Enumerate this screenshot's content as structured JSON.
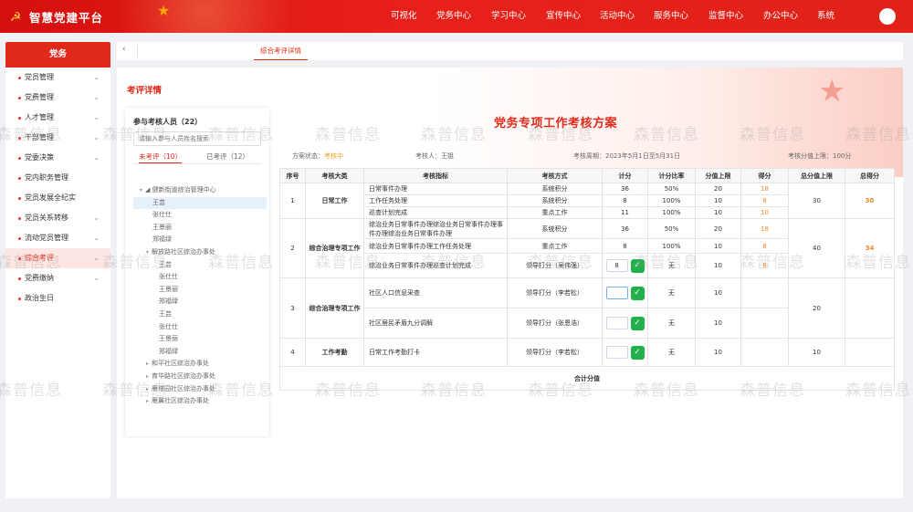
{
  "header": {
    "app_title": "智慧党建平台",
    "nav": [
      "可视化",
      "党务中心",
      "学习中心",
      "宣传中心",
      "活动中心",
      "服务中心",
      "监督中心",
      "办公中心",
      "系统"
    ]
  },
  "sidebar": {
    "title": "党务",
    "items": [
      {
        "label": "党员管理",
        "expandable": true
      },
      {
        "label": "党费管理",
        "expandable": true
      },
      {
        "label": "人才管理",
        "expandable": true
      },
      {
        "label": "干部管理",
        "expandable": true
      },
      {
        "label": "党委决策",
        "expandable": true
      },
      {
        "label": "党内职务管理",
        "expandable": false
      },
      {
        "label": "党员发展全纪实",
        "expandable": false
      },
      {
        "label": "党员关系转移",
        "expandable": true
      },
      {
        "label": "流动党员管理",
        "expandable": true
      },
      {
        "label": "综合考评",
        "expandable": true,
        "active": true
      },
      {
        "label": "党费缴纳",
        "expandable": true
      },
      {
        "label": "政治生日",
        "expandable": false
      }
    ]
  },
  "tabs": {
    "back_icon": "‹",
    "active_tab": "综合考评详情"
  },
  "main": {
    "section_title": "考评详情",
    "plan_title": "党务专项工作考核方案",
    "info": {
      "status_label": "方案状态：",
      "status_value": "考核中",
      "assessor": "考核人：王姐",
      "period": "考核周期：2023年5月1日至5月31日",
      "score_cap": "考核分值上限：100分"
    }
  },
  "tree": {
    "title": "参与考核人员（22）",
    "search_placeholder": "请输入参与人员姓名搜索",
    "tab_pending": "未考评（10）",
    "tab_done": "已考评（12）",
    "rows": [
      {
        "label": "◢ 健新街道综治管理中心",
        "arrow": "▾",
        "indent": 1
      },
      {
        "label": "王芸",
        "indent": 3,
        "selected": true
      },
      {
        "label": "张仕仕",
        "indent": 3
      },
      {
        "label": "王景丽",
        "indent": 3
      },
      {
        "label": "郑福绿",
        "indent": 3
      },
      {
        "label": "解放路社区综治办事处",
        "arrow": "▾",
        "indent": 2
      },
      {
        "label": "王芸",
        "indent": 4
      },
      {
        "label": "张仕仕",
        "indent": 4
      },
      {
        "label": "王景丽",
        "indent": 4
      },
      {
        "label": "郑福绿",
        "indent": 4
      },
      {
        "label": "王芸",
        "indent": 4
      },
      {
        "label": "张仕仕",
        "indent": 4
      },
      {
        "label": "王景丽",
        "indent": 4
      },
      {
        "label": "郑福绿",
        "indent": 4
      },
      {
        "label": "和平社区综治办事处",
        "arrow": "▸",
        "indent": 2
      },
      {
        "label": "育华路社区综治办事处",
        "arrow": "▸",
        "indent": 2
      },
      {
        "label": "雁塔园社区综治办事处",
        "arrow": "▸",
        "indent": 2
      },
      {
        "label": "雁翼社区综治办事处",
        "arrow": "▸",
        "indent": 2
      }
    ]
  },
  "table": {
    "headers": [
      "序号",
      "考核大类",
      "考核指标",
      "考核方式",
      "计分",
      "计分比率",
      "分值上限",
      "得分",
      "总分值上限",
      "总得分"
    ],
    "groups": [
      {
        "no": "1",
        "category": "日常工作",
        "total_cap": "30",
        "total_score": "30",
        "rows": [
          {
            "indicator": "日常事件办理",
            "method": "系统积分",
            "score": "36",
            "ratio": "50%",
            "cap": "20",
            "got": "18"
          },
          {
            "indicator": "工作任务处理",
            "method": "系统积分",
            "score": "8",
            "ratio": "100%",
            "cap": "10",
            "got": "8"
          },
          {
            "indicator": "巡查计划完成",
            "method": "重点工作",
            "score": "11",
            "ratio": "100%",
            "cap": "10",
            "got": "10"
          }
        ]
      },
      {
        "no": "2",
        "category": "综合治理专项工作",
        "total_cap": "40",
        "total_score": "34",
        "rows": [
          {
            "indicator": "综治业务日常事件办理综治业务日常事件办理事件办理综治业务日常事件办理",
            "method": "系统积分",
            "score": "36",
            "ratio": "50%",
            "cap": "20",
            "got": "18"
          },
          {
            "indicator": "综治业务日常事件办理工作任务处理",
            "method": "重点工作",
            "score": "8",
            "ratio": "100%",
            "cap": "10",
            "got": "8"
          },
          {
            "indicator": "综治业务日常事件办理巡查计划完成",
            "method": "领导打分（吴伟强）",
            "score_input": "8",
            "ratio": "无",
            "cap": "10",
            "got": "8"
          }
        ]
      },
      {
        "no": "3",
        "category": "综合治理专项工作",
        "total_cap": "20",
        "total_score": "",
        "rows": [
          {
            "indicator": "社区人口信息采查",
            "method": "领导打分（李若松）",
            "score_input": "",
            "ratio": "无",
            "cap": "10",
            "got": ""
          },
          {
            "indicator": "社区居民矛盾九分调解",
            "method": "领导打分（张恩浩）",
            "score_input": "",
            "ratio": "无",
            "cap": "10",
            "got": ""
          }
        ]
      },
      {
        "no": "4",
        "category": "工作考勤",
        "total_cap": "10",
        "total_score": "",
        "rows": [
          {
            "indicator": "日常工作考勤打卡",
            "method": "领导打分（李若松）",
            "score_input": "",
            "ratio": "无",
            "cap": "10",
            "got": ""
          }
        ]
      }
    ],
    "total_label": "合计分值"
  },
  "watermark": "森普信息",
  "icons": {
    "emblem": "party-emblem-icon",
    "confirm": "check-icon",
    "expand": "chevron-down-icon"
  },
  "colors": {
    "brand_red": "#e22a1a",
    "accent_orange": "#f08a2a",
    "confirm_green": "#21b14b"
  }
}
